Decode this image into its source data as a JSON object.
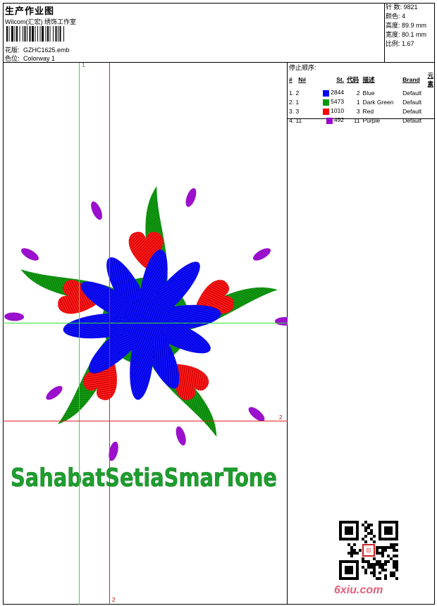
{
  "header": {
    "title": "生产作业图",
    "studio": "Wilcom(汇宏) 绣饰工作室",
    "design_label": "花版:",
    "design_value": "GZHC1625.emb",
    "colorway_label": "色位:",
    "colorway_value": "Colorway 1"
  },
  "stats": {
    "stitches": "针 数: 9821",
    "colors": "颜色: 4",
    "height": "高度: 89.9 mm",
    "width": "宽度: 80.1 mm",
    "scale": "比例: 1.67"
  },
  "stop_sequence": {
    "title": "停止顺序:",
    "headers": [
      "#",
      "N#",
      "St.",
      "代码",
      "描述",
      "Brand",
      "元素"
    ],
    "rows": [
      {
        "no": "1. 2",
        "color": "#0000ff",
        "st": "2844",
        "code": "2",
        "desc": "Blue",
        "brand": "Default"
      },
      {
        "no": "2. 1",
        "color": "#009900",
        "st": "5473",
        "code": "1",
        "desc": "Dark Green",
        "brand": "Default"
      },
      {
        "no": "3. 3",
        "color": "#ff0000",
        "st": "1010",
        "code": "3",
        "desc": "Red",
        "brand": "Default"
      },
      {
        "no": "4. 11",
        "color": "#9900cc",
        "st": "492",
        "code": "11",
        "desc": "Purple",
        "brand": "Default"
      }
    ]
  },
  "guides": {
    "green_label": "1",
    "red_label_right": "2",
    "red_label_bottom": "2"
  },
  "design": {
    "text": "SahabatSetiaSmarTone",
    "text_color": "#1e9e2e"
  },
  "watermark": "6xiu.com"
}
